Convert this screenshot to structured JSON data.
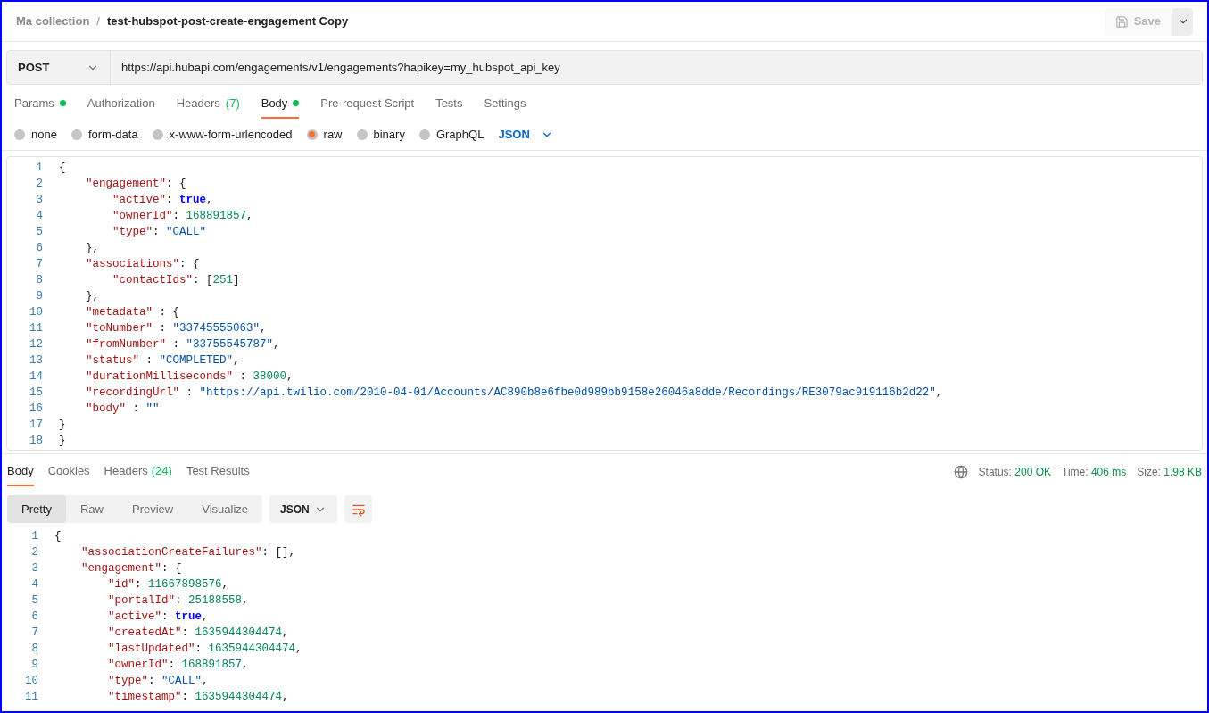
{
  "breadcrumb": {
    "collection": "Ma collection",
    "separator": "/",
    "request": "test-hubspot-post-create-engagement Copy"
  },
  "save_button": {
    "label": "Save",
    "disabled": true
  },
  "request_bar": {
    "method": "POST",
    "url": "https://api.hubapi.com/engagements/v1/engagements?hapikey=my_hubspot_api_key"
  },
  "request_tabs": [
    {
      "label": "Params",
      "dot": true,
      "selected": false
    },
    {
      "label": "Authorization",
      "dot": false,
      "selected": false
    },
    {
      "label": "Headers",
      "count": "(7)",
      "dot": false,
      "selected": false
    },
    {
      "label": "Body",
      "dot": true,
      "selected": true
    },
    {
      "label": "Pre-request Script",
      "dot": false,
      "selected": false
    },
    {
      "label": "Tests",
      "dot": false,
      "selected": false
    },
    {
      "label": "Settings",
      "dot": false,
      "selected": false
    }
  ],
  "body_types": [
    {
      "label": "none",
      "selected": false
    },
    {
      "label": "form-data",
      "selected": false
    },
    {
      "label": "x-www-form-urlencoded",
      "selected": false
    },
    {
      "label": "raw",
      "selected": true
    },
    {
      "label": "binary",
      "selected": false
    },
    {
      "label": "GraphQL",
      "selected": false
    }
  ],
  "body_format": "JSON",
  "request_body": [
    {
      "n": "1",
      "tokens": [
        {
          "kind": "punct",
          "text": "{"
        }
      ]
    },
    {
      "n": "2",
      "tokens": [
        {
          "kind": "key",
          "text": "    \"engagement\""
        },
        {
          "kind": "punct",
          "text": ": {"
        }
      ]
    },
    {
      "n": "3",
      "tokens": [
        {
          "kind": "key",
          "text": "        \"active\""
        },
        {
          "kind": "punct",
          "text": ": "
        },
        {
          "kind": "bool",
          "text": "true"
        },
        {
          "kind": "punct",
          "text": ","
        }
      ]
    },
    {
      "n": "4",
      "tokens": [
        {
          "kind": "key",
          "text": "        \"ownerId\""
        },
        {
          "kind": "punct",
          "text": ": "
        },
        {
          "kind": "number",
          "text": "168891857"
        },
        {
          "kind": "punct",
          "text": ","
        }
      ]
    },
    {
      "n": "5",
      "tokens": [
        {
          "kind": "key",
          "text": "        \"type\""
        },
        {
          "kind": "punct",
          "text": ": "
        },
        {
          "kind": "string",
          "text": "\"CALL\""
        }
      ]
    },
    {
      "n": "6",
      "tokens": [
        {
          "kind": "punct",
          "text": "    },"
        }
      ]
    },
    {
      "n": "7",
      "tokens": [
        {
          "kind": "key",
          "text": "    \"associations\""
        },
        {
          "kind": "punct",
          "text": ": {"
        }
      ]
    },
    {
      "n": "8",
      "tokens": [
        {
          "kind": "key",
          "text": "        \"contactIds\""
        },
        {
          "kind": "punct",
          "text": ": ["
        },
        {
          "kind": "number",
          "text": "251"
        },
        {
          "kind": "punct",
          "text": "]"
        }
      ]
    },
    {
      "n": "9",
      "tokens": [
        {
          "kind": "punct",
          "text": "    },"
        }
      ]
    },
    {
      "n": "10",
      "tokens": [
        {
          "kind": "key",
          "text": "    \"metadata\""
        },
        {
          "kind": "punct",
          "text": " : {"
        }
      ]
    },
    {
      "n": "11",
      "tokens": [
        {
          "kind": "key",
          "text": "    \"toNumber\""
        },
        {
          "kind": "punct",
          "text": " : "
        },
        {
          "kind": "string",
          "text": "\"33745555063\""
        },
        {
          "kind": "punct",
          "text": ","
        }
      ]
    },
    {
      "n": "12",
      "tokens": [
        {
          "kind": "key",
          "text": "    \"fromNumber\""
        },
        {
          "kind": "punct",
          "text": " : "
        },
        {
          "kind": "string",
          "text": "\"33755545787\""
        },
        {
          "kind": "punct",
          "text": ","
        }
      ]
    },
    {
      "n": "13",
      "tokens": [
        {
          "kind": "key",
          "text": "    \"status\""
        },
        {
          "kind": "punct",
          "text": " : "
        },
        {
          "kind": "string",
          "text": "\"COMPLETED\""
        },
        {
          "kind": "punct",
          "text": ","
        }
      ]
    },
    {
      "n": "14",
      "tokens": [
        {
          "kind": "key",
          "text": "    \"durationMilliseconds\""
        },
        {
          "kind": "punct",
          "text": " : "
        },
        {
          "kind": "number",
          "text": "38000"
        },
        {
          "kind": "punct",
          "text": ","
        }
      ]
    },
    {
      "n": "15",
      "tokens": [
        {
          "kind": "key",
          "text": "    \"recordingUrl\""
        },
        {
          "kind": "punct",
          "text": " : "
        },
        {
          "kind": "string",
          "text": "\"https://api.twilio.com/2010-04-01/Accounts/AC890b8e6fbe0d989bb9158e26046a8dde/Recordings/RE3079ac919116b2d22\""
        },
        {
          "kind": "punct",
          "text": ","
        }
      ]
    },
    {
      "n": "16",
      "tokens": [
        {
          "kind": "key",
          "text": "    \"body\""
        },
        {
          "kind": "punct",
          "text": " : "
        },
        {
          "kind": "string",
          "text": "\"\""
        }
      ]
    },
    {
      "n": "17",
      "tokens": [
        {
          "kind": "punct",
          "text": "}"
        }
      ]
    },
    {
      "n": "18",
      "tokens": [
        {
          "kind": "punct",
          "text": "}"
        }
      ]
    }
  ],
  "response_tabs": [
    {
      "label": "Body",
      "selected": true
    },
    {
      "label": "Cookies",
      "selected": false
    },
    {
      "label": "Headers",
      "count": "(24)",
      "selected": false
    },
    {
      "label": "Test Results",
      "selected": false
    }
  ],
  "response_meta": [
    {
      "label": "Status:",
      "value": "200 OK"
    },
    {
      "label": "Time:",
      "value": "406 ms"
    },
    {
      "label": "Size:",
      "value": "1.98 KB"
    }
  ],
  "view_modes": [
    {
      "label": "Pretty",
      "selected": true
    },
    {
      "label": "Raw",
      "selected": false
    },
    {
      "label": "Preview",
      "selected": false
    },
    {
      "label": "Visualize",
      "selected": false
    }
  ],
  "response_format": "JSON",
  "response_body": [
    {
      "n": "1",
      "tokens": [
        {
          "kind": "punct",
          "text": "{"
        }
      ]
    },
    {
      "n": "2",
      "tokens": [
        {
          "kind": "key",
          "text": "    \"associationCreateFailures\""
        },
        {
          "kind": "punct",
          "text": ": [],"
        }
      ]
    },
    {
      "n": "3",
      "tokens": [
        {
          "kind": "key",
          "text": "    \"engagement\""
        },
        {
          "kind": "punct",
          "text": ": {"
        }
      ]
    },
    {
      "n": "4",
      "tokens": [
        {
          "kind": "key",
          "text": "        \"id\""
        },
        {
          "kind": "punct",
          "text": ": "
        },
        {
          "kind": "number",
          "text": "11667898576"
        },
        {
          "kind": "punct",
          "text": ","
        }
      ]
    },
    {
      "n": "5",
      "tokens": [
        {
          "kind": "key",
          "text": "        \"portalId\""
        },
        {
          "kind": "punct",
          "text": ": "
        },
        {
          "kind": "number",
          "text": "25188558"
        },
        {
          "kind": "punct",
          "text": ","
        }
      ]
    },
    {
      "n": "6",
      "tokens": [
        {
          "kind": "key",
          "text": "        \"active\""
        },
        {
          "kind": "punct",
          "text": ": "
        },
        {
          "kind": "bool",
          "text": "true"
        },
        {
          "kind": "punct",
          "text": ","
        }
      ]
    },
    {
      "n": "7",
      "tokens": [
        {
          "kind": "key",
          "text": "        \"createdAt\""
        },
        {
          "kind": "punct",
          "text": ": "
        },
        {
          "kind": "number",
          "text": "1635944304474"
        },
        {
          "kind": "punct",
          "text": ","
        }
      ]
    },
    {
      "n": "8",
      "tokens": [
        {
          "kind": "key",
          "text": "        \"lastUpdated\""
        },
        {
          "kind": "punct",
          "text": ": "
        },
        {
          "kind": "number",
          "text": "1635944304474"
        },
        {
          "kind": "punct",
          "text": ","
        }
      ]
    },
    {
      "n": "9",
      "tokens": [
        {
          "kind": "key",
          "text": "        \"ownerId\""
        },
        {
          "kind": "punct",
          "text": ": "
        },
        {
          "kind": "number",
          "text": "168891857"
        },
        {
          "kind": "punct",
          "text": ","
        }
      ]
    },
    {
      "n": "10",
      "tokens": [
        {
          "kind": "key",
          "text": "        \"type\""
        },
        {
          "kind": "punct",
          "text": ": "
        },
        {
          "kind": "string",
          "text": "\"CALL\""
        },
        {
          "kind": "punct",
          "text": ","
        }
      ]
    },
    {
      "n": "11",
      "tokens": [
        {
          "kind": "key",
          "text": "        \"timestamp\""
        },
        {
          "kind": "punct",
          "text": ": "
        },
        {
          "kind": "number",
          "text": "1635944304474"
        },
        {
          "kind": "punct",
          "text": ","
        }
      ]
    }
  ]
}
